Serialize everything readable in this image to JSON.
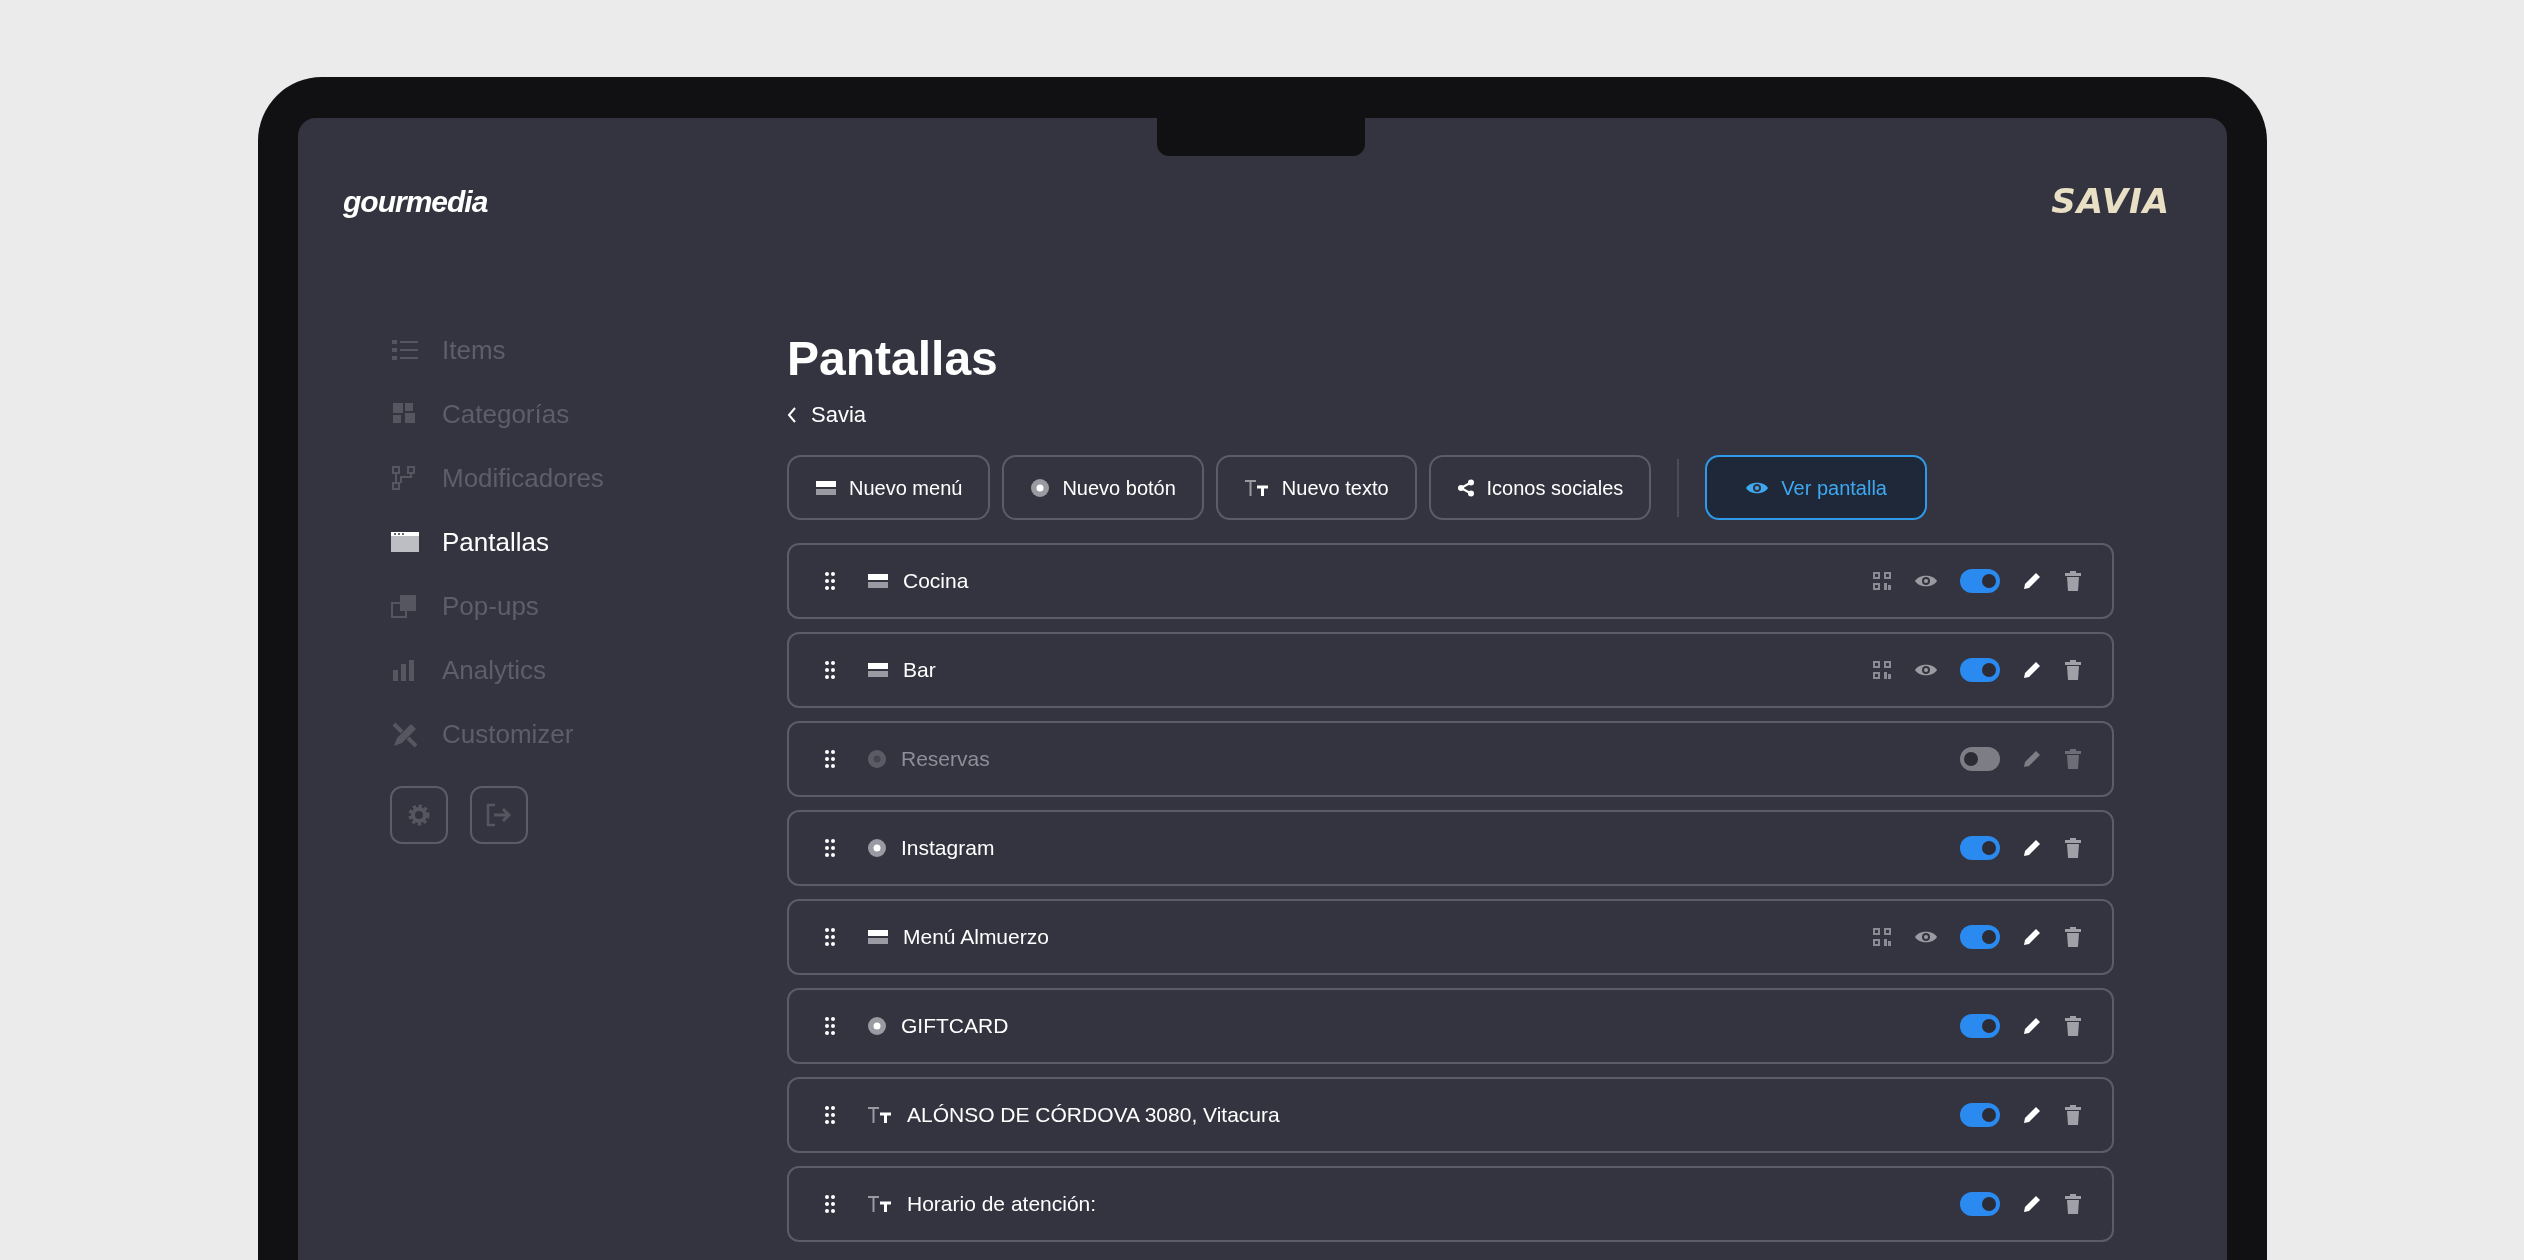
{
  "header": {
    "brand": "gourmedia",
    "client_logo": "SAVIA"
  },
  "sidebar": {
    "items": [
      {
        "label": "Items",
        "selected": false
      },
      {
        "label": "Categorías",
        "selected": false
      },
      {
        "label": "Modificadores",
        "selected": false
      },
      {
        "label": "Pantallas",
        "selected": true
      },
      {
        "label": "Pop-ups",
        "selected": false
      },
      {
        "label": "Analytics",
        "selected": false
      },
      {
        "label": "Customizer",
        "selected": false
      }
    ]
  },
  "page": {
    "title": "Pantallas",
    "back": "Savia"
  },
  "toolbar": [
    {
      "kind": "menu",
      "label": "Nuevo menú"
    },
    {
      "kind": "button",
      "label": "Nuevo botón"
    },
    {
      "kind": "text",
      "label": "Nuevo texto"
    },
    {
      "kind": "social",
      "label": "Iconos sociales"
    },
    {
      "kind": "view",
      "label": "Ver pantalla"
    }
  ],
  "screens": [
    {
      "kind": "menu",
      "label": "Cocina",
      "on": true
    },
    {
      "kind": "menu",
      "label": "Bar",
      "on": true
    },
    {
      "kind": "button",
      "label": "Reservas",
      "on": false
    },
    {
      "kind": "button",
      "label": "Instagram",
      "on": true
    },
    {
      "kind": "menu",
      "label": "Menú Almuerzo",
      "on": true
    },
    {
      "kind": "button",
      "label": "GIFTCARD",
      "on": true
    },
    {
      "kind": "text",
      "label": "ALÓNSO DE CÓRDOVA 3080, Vitacura",
      "on": true
    },
    {
      "kind": "text",
      "label": "Horario de atención:",
      "on": true
    }
  ]
}
